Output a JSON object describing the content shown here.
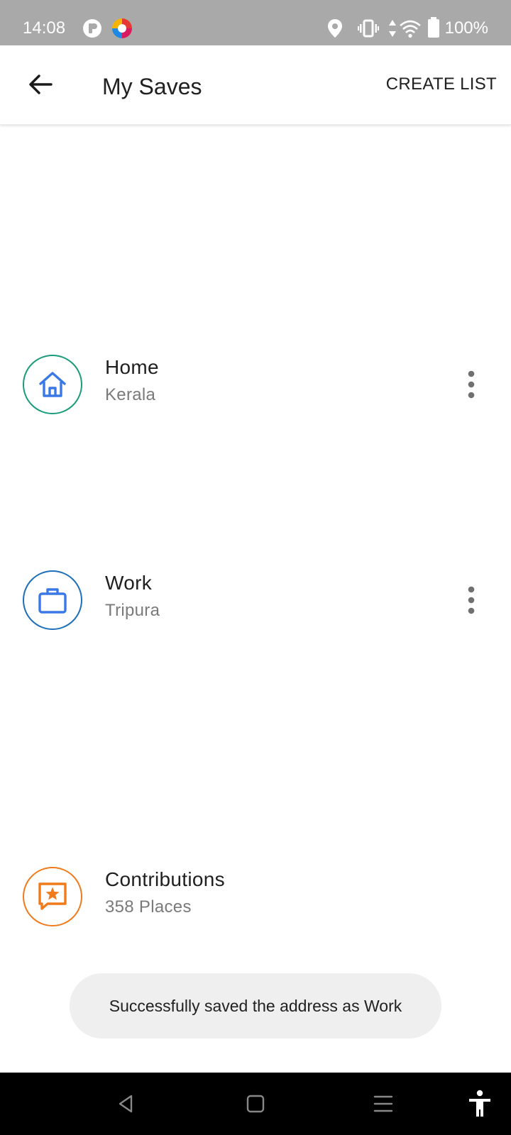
{
  "status_bar": {
    "time": "14:08",
    "battery": "100%",
    "icons": [
      "app-notification-icon",
      "colorful-app-icon",
      "location-icon",
      "vibrate-icon",
      "data-arrows-icon",
      "wifi-icon",
      "battery-icon"
    ]
  },
  "app_bar": {
    "title": "My Saves",
    "action": "CREATE LIST",
    "back_icon": "arrow-back-icon"
  },
  "lists": [
    {
      "title": "Home",
      "subtitle": "Kerala",
      "icon": "home-icon",
      "ring_color": "#1a9c7a",
      "icon_color": "#3b78e7"
    },
    {
      "title": "Work",
      "subtitle": "Tripura",
      "icon": "briefcase-icon",
      "ring_color": "#1c6fb8",
      "icon_color": "#3b78e7"
    },
    {
      "title": "Contributions",
      "subtitle": "358 Places",
      "icon": "star-message-icon",
      "ring_color": "#f07b1d",
      "icon_color": "#f07b1d"
    }
  ],
  "toast": {
    "text": "Successfully saved the address as Work"
  },
  "nav_bar": {
    "icons": [
      "back-triangle-icon",
      "home-square-icon",
      "recents-menu-icon",
      "accessibility-icon"
    ]
  }
}
